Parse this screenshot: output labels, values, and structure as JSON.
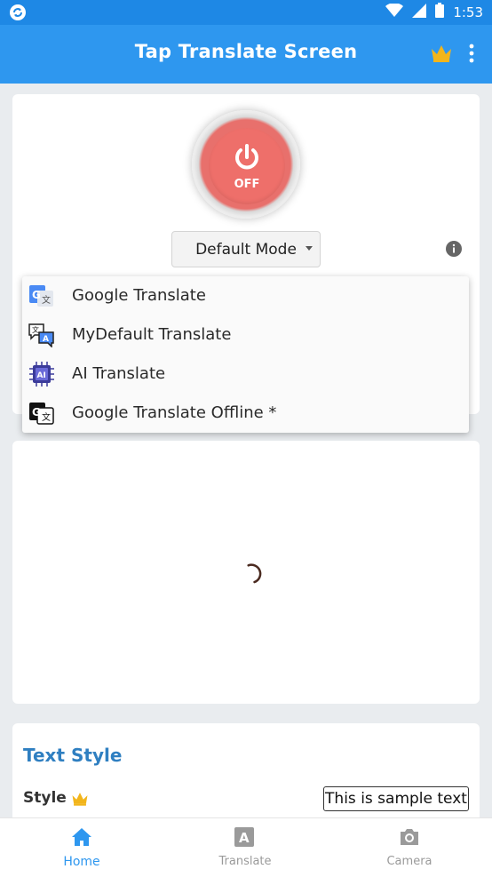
{
  "status_bar": {
    "time": "1:53"
  },
  "app_bar": {
    "title": "Tap Translate Screen"
  },
  "power": {
    "state_label": "OFF"
  },
  "mode_dropdown": {
    "selected": "Default Mode"
  },
  "translator_menu": {
    "items": [
      {
        "label": "Google Translate",
        "icon": "google-translate-icon"
      },
      {
        "label": "MyDefault Translate",
        "icon": "chat-translate-icon"
      },
      {
        "label": "AI Translate",
        "icon": "ai-chip-icon"
      },
      {
        "label": "Google Translate Offline *",
        "icon": "google-translate-offline-icon"
      }
    ]
  },
  "text_style": {
    "title": "Text Style",
    "style_label": "Style",
    "sample_text": "This is sample text"
  },
  "bottom_nav": {
    "home": "Home",
    "translate": "Translate",
    "camera": "Camera"
  },
  "colors": {
    "primary": "#2e97ef",
    "status_bar": "#1e88e5",
    "power_off": "#ee6f6a",
    "accent_text": "#2f7fc1",
    "crown": "#f2b51b"
  }
}
